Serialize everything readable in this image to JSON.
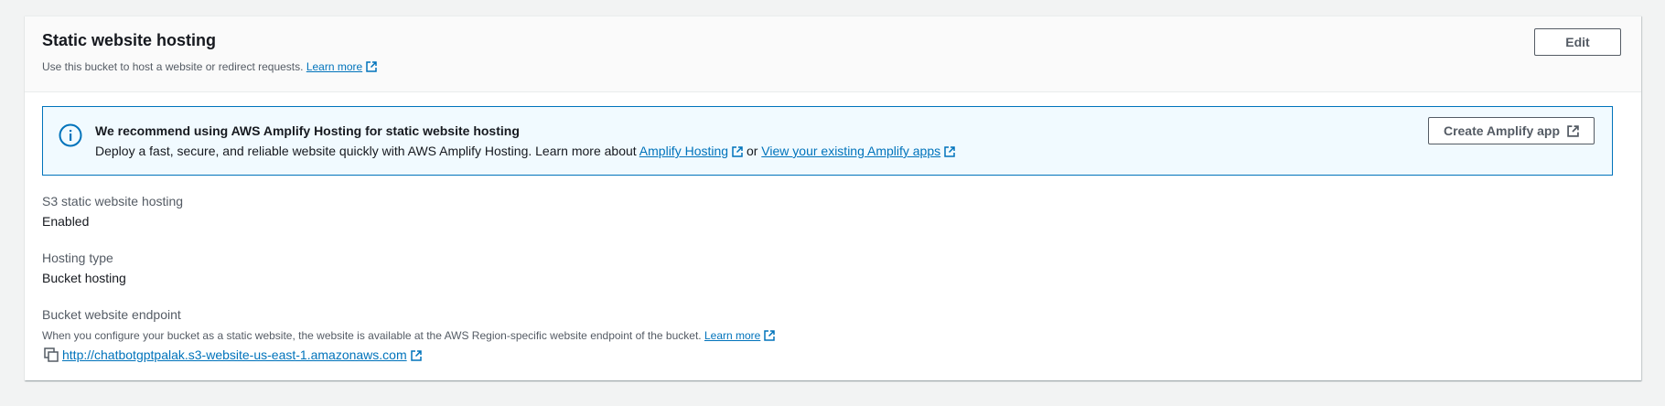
{
  "header": {
    "title": "Static website hosting",
    "subtitle": "Use this bucket to host a website or redirect requests.",
    "learn_more": "Learn more",
    "edit_label": "Edit"
  },
  "alert": {
    "title": "We recommend using AWS Amplify Hosting for static website hosting",
    "body_prefix": "Deploy a fast, secure, and reliable website quickly with AWS Amplify Hosting. Learn more about",
    "link1": "Amplify Hosting",
    "or_text": "or",
    "link2": "View your existing Amplify apps",
    "button_label": "Create Amplify app",
    "icon": "info-icon"
  },
  "fields": {
    "hosting_label": "S3 static website hosting",
    "hosting_value": "Enabled",
    "type_label": "Hosting type",
    "type_value": "Bucket hosting",
    "endpoint_label": "Bucket website endpoint",
    "endpoint_desc": "When you configure your bucket as a static website, the website is available at the AWS Region-specific website endpoint of the bucket.",
    "endpoint_learn_more": "Learn more",
    "endpoint_url": "http://chatbotgptpalak.s3-website-us-east-1.amazonaws.com"
  },
  "colors": {
    "link": "#0073bb",
    "alert_bg": "#f1faff",
    "alert_border": "#0073bb",
    "page_bg": "#f2f3f3"
  }
}
